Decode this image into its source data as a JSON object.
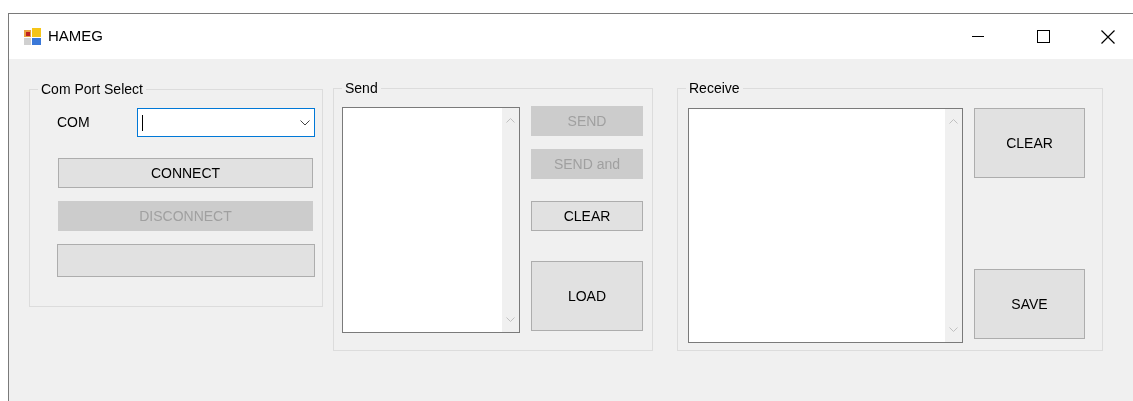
{
  "window": {
    "title": "HAMEG"
  },
  "com_port_group": {
    "title": "Com Port Select",
    "label": "COM",
    "combo": {
      "focused": true
    },
    "buttons": [
      {
        "label": "CONNECT",
        "disabled": false
      },
      {
        "label": "DISCONNECT",
        "disabled": true
      },
      {
        "disabled": false
      }
    ]
  },
  "send_group": {
    "title": "Send",
    "buttons": [
      {
        "label": "SEND",
        "disabled": true
      },
      {
        "label": "SEND and",
        "disabled": true
      },
      {
        "label": "CLEAR",
        "disabled": false
      },
      {
        "label": "LOAD",
        "disabled": false
      }
    ]
  },
  "receive_group": {
    "title": "Receive",
    "buttons": [
      {
        "label": "CLEAR",
        "disabled": false
      },
      {
        "label": "SAVE",
        "disabled": false
      }
    ]
  }
}
